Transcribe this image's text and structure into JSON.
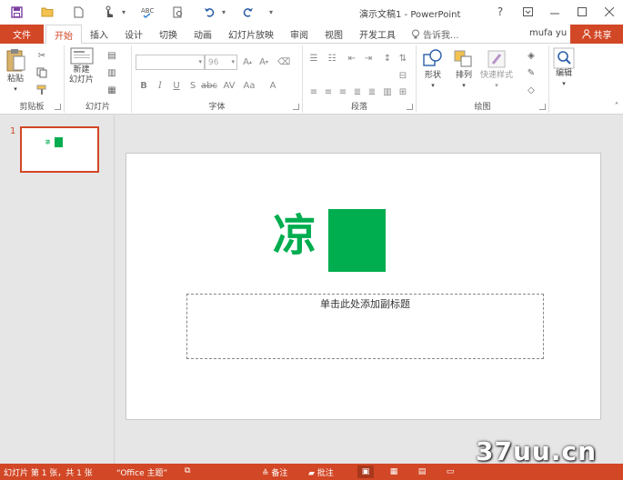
{
  "window": {
    "title": "演示文稿1 - PowerPoint",
    "qat_icons": [
      "save-icon",
      "open-folder-icon",
      "new-file-icon",
      "touch-mode-icon",
      "spelling-icon",
      "print-preview-icon",
      "undo-icon",
      "redo-icon",
      "customize-qat-icon"
    ],
    "controls": [
      "help-icon",
      "ribbon-display-icon",
      "minimize-icon",
      "maximize-icon",
      "close-icon"
    ]
  },
  "tabs": {
    "file": "文件",
    "items": [
      "开始",
      "插入",
      "设计",
      "切换",
      "动画",
      "幻灯片放映",
      "审阅",
      "视图",
      "开发工具"
    ],
    "active": "开始",
    "tell_me": "告诉我...",
    "user": "mufa yu",
    "share": "共享"
  },
  "ribbon": {
    "clipboard": {
      "label": "剪贴板",
      "paste": "粘贴"
    },
    "slides": {
      "label": "幻灯片",
      "new_slide_1": "新建",
      "new_slide_2": "幻灯片"
    },
    "font": {
      "label": "字体",
      "font_name": "",
      "font_size": "96"
    },
    "paragraph": {
      "label": "段落"
    },
    "drawing": {
      "label": "绘图",
      "shapes": "形状",
      "arrange": "排列",
      "quick_styles": "快速样式"
    },
    "editing": {
      "label": "编辑"
    }
  },
  "thumbnails": [
    {
      "number": "1",
      "char": "凉"
    }
  ],
  "slide": {
    "title_char": "凉",
    "subtitle_placeholder": "单击此处添加副标题",
    "accent_color": "#00ad4f"
  },
  "status": {
    "slide_info": "幻灯片 第 1 张，共 1 张",
    "theme": "“Office 主题”",
    "notes": "备注",
    "comments": "批注"
  },
  "watermark": "37uu.cn",
  "colors": {
    "brand": "#d24726",
    "green": "#00ad4f"
  }
}
